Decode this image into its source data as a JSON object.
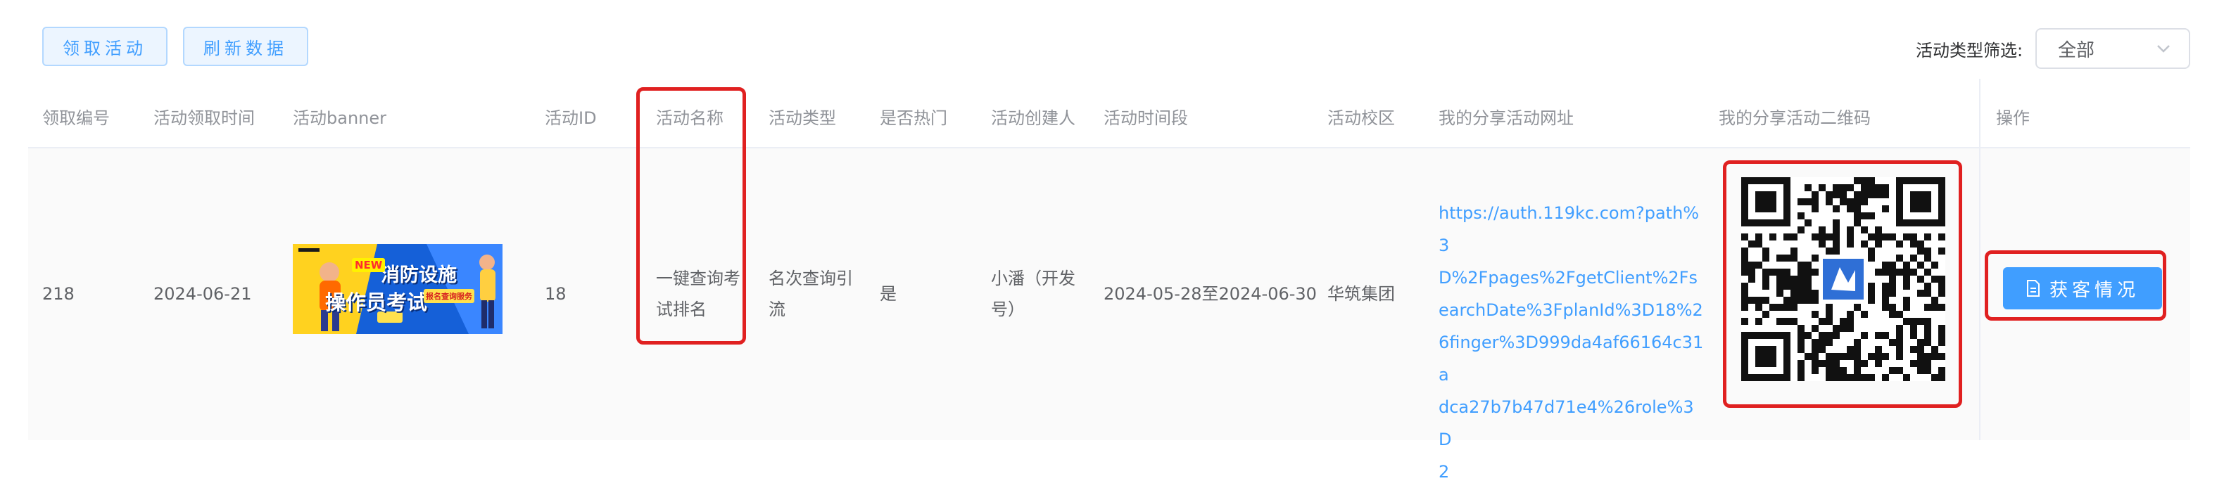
{
  "toolbar": {
    "claim_label": "领取活动",
    "refresh_label": "刷新数据",
    "filter_label": "活动类型筛选:",
    "filter_value": "全部"
  },
  "columns": [
    "领取编号",
    "活动领取时间",
    "活动banner",
    "活动ID",
    "活动名称",
    "活动类型",
    "是否热门",
    "活动创建人",
    "活动时间段",
    "活动校区",
    "我的分享活动网址",
    "我的分享活动二维码",
    "操作"
  ],
  "row": {
    "claim_no": "218",
    "claim_time": "2024-06-21",
    "banner": {
      "line1": "消防设施",
      "line2": "操作员考试",
      "badge": "NEW",
      "sub": "报名查询服务"
    },
    "activity_id": "18",
    "name_line1": "一键查询考",
    "name_line2": "试排名",
    "type_line1": "名次查询引",
    "type_line2": "流",
    "is_hot": "是",
    "creator_line1": "小潘（开发",
    "creator_line2": "号）",
    "period": "2024-05-28至2024-06-30",
    "campus": "华筑集团",
    "share_url_lines": [
      "https://auth.119kc.com?path%3",
      "D%2Fpages%2FgetClient%2Fs",
      "earchDate%3FplanId%3D18%2",
      "6finger%3D999da4af66164c31a",
      "dca27b7b47d71e4%26role%3D",
      "2"
    ],
    "action_label": "获客情况"
  },
  "colors": {
    "primary": "#409eff",
    "highlight": "#e02020",
    "header_text": "#909399",
    "body_text": "#606266"
  },
  "icons": {
    "select_arrow": "chevron-down-icon",
    "action_icon": "document-icon",
    "qr": "qr-code-icon"
  }
}
